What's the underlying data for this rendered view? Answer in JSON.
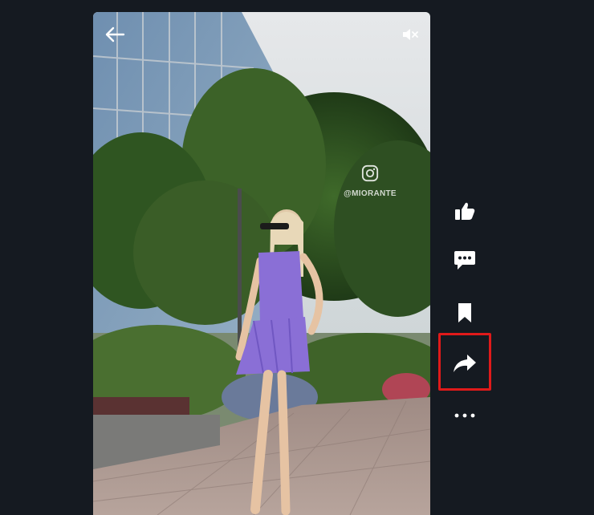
{
  "video": {
    "watermark_handle": "@MIORANTE",
    "icons": {
      "back": "arrow-left-icon",
      "mute": "volume-muted-icon",
      "watermark": "instagram-icon"
    }
  },
  "actions": [
    {
      "id": "like",
      "icon": "thumbs-up-icon"
    },
    {
      "id": "comment",
      "icon": "comment-bubble-icon"
    },
    {
      "id": "save",
      "icon": "bookmark-icon"
    },
    {
      "id": "share",
      "icon": "share-arrow-icon",
      "highlighted": true
    },
    {
      "id": "more",
      "icon": "more-dots-icon"
    }
  ],
  "colors": {
    "background": "#151a21",
    "icon": "#ffffff",
    "highlight": "#e01a1a",
    "dress": "#8a6fd6"
  }
}
